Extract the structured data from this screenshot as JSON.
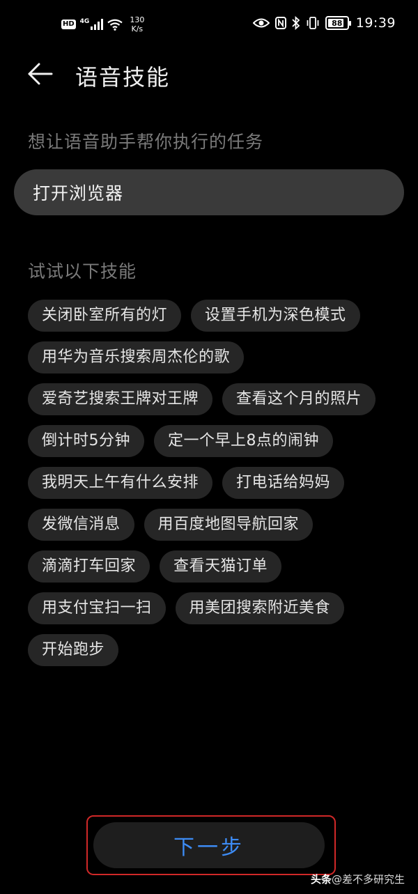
{
  "status_bar": {
    "hd_label": "HD",
    "network_type": "4G",
    "speed_value": "130",
    "speed_unit": "K/s",
    "battery_percent": "88",
    "battery_level": 0.88,
    "time": "19:39"
  },
  "header": {
    "back_icon": "arrow-left-icon",
    "title": "语音技能"
  },
  "task_section": {
    "label": "想让语音助手帮你执行的任务",
    "input_value": "打开浏览器"
  },
  "skills_section": {
    "label": "试试以下技能",
    "rows": [
      [
        "关闭卧室所有的灯",
        "设置手机为深色模式"
      ],
      [
        "用华为音乐搜索周杰伦的歌"
      ],
      [
        "爱奇艺搜索王牌对王牌",
        "查看这个月的照片"
      ],
      [
        "倒计时5分钟",
        "定一个早上8点的闹钟"
      ],
      [
        "我明天上午有什么安排",
        "打电话给妈妈"
      ],
      [
        "发微信消息",
        "用百度地图导航回家"
      ],
      [
        "滴滴打车回家",
        "查看天猫订单"
      ],
      [
        "用支付宝扫一扫",
        "用美团搜索附近美食"
      ],
      [
        "开始跑步"
      ]
    ]
  },
  "footer": {
    "next_label": "下一步"
  },
  "watermark": {
    "brand": "头条",
    "handle": "@差不多研究生"
  },
  "colors": {
    "background": "#000000",
    "input_background": "#3a3a3a",
    "chip_background": "#262626",
    "accent_blue": "#3d8cf5",
    "highlight_red": "#d02828"
  }
}
